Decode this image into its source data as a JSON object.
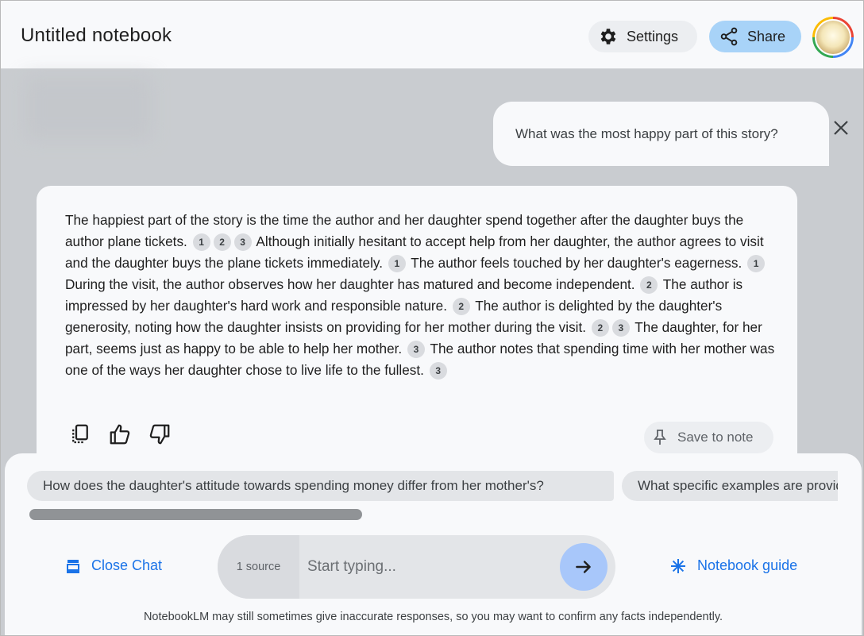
{
  "header": {
    "title": "Untitled notebook",
    "settings_label": "Settings",
    "share_label": "Share"
  },
  "user_message": "What was the most happy part of this story?",
  "response": {
    "segments": [
      {
        "t": "The happiest part of the story is the time the author and her daughter spend together after the daughter buys the author plane tickets. "
      },
      {
        "c": "1"
      },
      {
        "c": "2"
      },
      {
        "c": "3"
      },
      {
        "t": " Although initially hesitant to accept help from her daughter, the author agrees to visit and the daughter buys the plane tickets immediately. "
      },
      {
        "c": "1"
      },
      {
        "t": " The author feels touched by her daughter's eagerness. "
      },
      {
        "c": "1"
      },
      {
        "t": " During the visit, the author observes how her daughter has matured and become independent. "
      },
      {
        "c": "2"
      },
      {
        "t": " The author is impressed by her daughter's hard work and responsible nature. "
      },
      {
        "c": "2"
      },
      {
        "t": " The author is delighted by the daughter's generosity, noting how the daughter insists on providing for her mother during the visit. "
      },
      {
        "c": "2"
      },
      {
        "c": "3"
      },
      {
        "t": " The daughter, for her part, seems just as happy to be able to help her mother. "
      },
      {
        "c": "3"
      },
      {
        "t": " The author notes that spending time with her mother was one of the ways her daughter chose to live life to the fullest. "
      },
      {
        "c": "3"
      }
    ],
    "save_label": "Save to note"
  },
  "suggestions": [
    "How does the daughter's attitude towards spending money differ from her mother's?",
    "What specific examples are provided"
  ],
  "bottom": {
    "close_chat_label": "Close Chat",
    "source_count": "1 source",
    "input_placeholder": "Start typing...",
    "guide_label": "Notebook guide",
    "disclaimer": "NotebookLM may still sometimes give inaccurate responses, so you may want to confirm any facts independently."
  },
  "colors": {
    "accent": "#1a73e8",
    "share_bg": "#a8d3f8",
    "send_bg": "#a8c7fa",
    "page_bg": "#c9ccd0"
  },
  "icons": [
    "gear-icon",
    "share-icon",
    "close-icon",
    "copy-icon",
    "thumbs-up-icon",
    "thumbs-down-icon",
    "pin-icon",
    "close-chat-icon",
    "arrow-right-icon",
    "sparkle-icon"
  ]
}
